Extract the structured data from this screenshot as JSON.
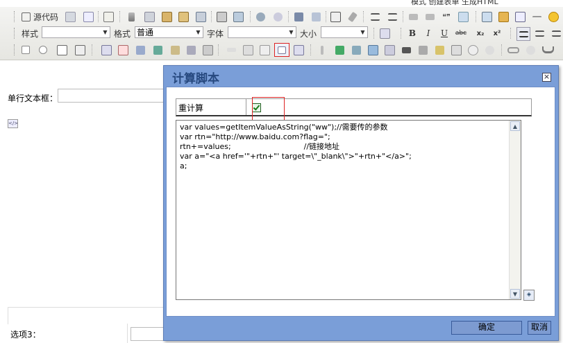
{
  "top_links": {
    "text": "模式   创建表单   生成HTML"
  },
  "toolbar": {
    "source_label": "源代码",
    "style_label": "样式",
    "format_label": "格式",
    "format_value": "普通",
    "font_label": "字体",
    "size_label": "大小",
    "bold": "B",
    "italic": "I",
    "underline": "U",
    "strike": "abc",
    "subscript": "x₂",
    "superscript": "x²",
    "quote": "❝❞"
  },
  "editor": {
    "field_label": "单行文本框：",
    "option_label": "选项3："
  },
  "dialog": {
    "title": "计算脚本",
    "close_glyph": "×",
    "recalc_label": "重计算",
    "recalc_checked": true,
    "code_lines": [
      "var values=getItemValueAsString(\"ww\");//需要传的参数",
      "var rtn=\"http://www.baidu.com?flag=\";",
      "rtn+=values;                              //链接地址",
      "var a=\"<a href='\"+rtn+\"' target=\\\"_blank\\\">\"+rtn+\"</a>\";",
      "a;"
    ],
    "ok_label": "确定",
    "cancel_label": "取消"
  },
  "colors": {
    "dialog_bg": "#7a9ed8",
    "dialog_title": "#27497f",
    "toolbar_bg": "#eeeeea",
    "highlight": "#dd2222"
  }
}
